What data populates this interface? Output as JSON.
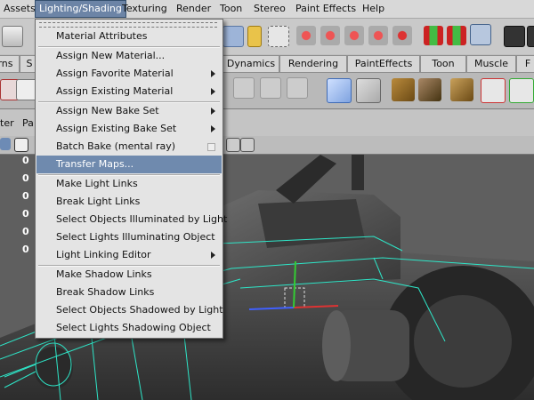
{
  "menubar": {
    "items": [
      "Assets",
      "Lighting/Shading",
      "Texturing",
      "Render",
      "Toon",
      "Stereo",
      "Paint Effects",
      "Help"
    ],
    "active_index": 1
  },
  "shelf": {
    "tabs": [
      "rns",
      "S",
      "Dynamics",
      "Rendering",
      "PaintEffects",
      "Toon",
      "Muscle",
      "F"
    ]
  },
  "panel": {
    "labels": [
      "ter",
      "Pa"
    ]
  },
  "channel_values": [
    "0",
    "0",
    "0",
    "0",
    "0",
    "0"
  ],
  "menu": {
    "title": "Lighting/Shading",
    "items": [
      {
        "label": "Material Attributes",
        "type": "plain"
      },
      {
        "label": "Assign New Material...",
        "type": "plain"
      },
      {
        "label": "Assign Favorite Material",
        "type": "submenu"
      },
      {
        "label": "Assign Existing Material",
        "type": "submenu"
      },
      {
        "label": "Assign New Bake Set",
        "type": "submenu"
      },
      {
        "label": "Assign Existing Bake Set",
        "type": "submenu"
      },
      {
        "label": "Batch Bake (mental ray)",
        "type": "option"
      },
      {
        "label": "Transfer Maps...",
        "type": "plain",
        "highlighted": true
      },
      {
        "label": "Make Light Links",
        "type": "plain"
      },
      {
        "label": "Break Light Links",
        "type": "plain"
      },
      {
        "label": "Select Objects Illuminated by Light",
        "type": "plain"
      },
      {
        "label": "Select Lights Illuminating Object",
        "type": "plain"
      },
      {
        "label": "Light Linking Editor",
        "type": "submenu"
      },
      {
        "label": "Make Shadow Links",
        "type": "plain"
      },
      {
        "label": "Break Shadow Links",
        "type": "plain"
      },
      {
        "label": "Select Objects Shadowed by Light",
        "type": "plain"
      },
      {
        "label": "Select Lights Shadowing Object",
        "type": "plain"
      }
    ]
  },
  "colors": {
    "menu_highlight": "#6f8aae",
    "wireframe": "#2ee6c8",
    "viewport_bg": "#5f5f5f"
  }
}
